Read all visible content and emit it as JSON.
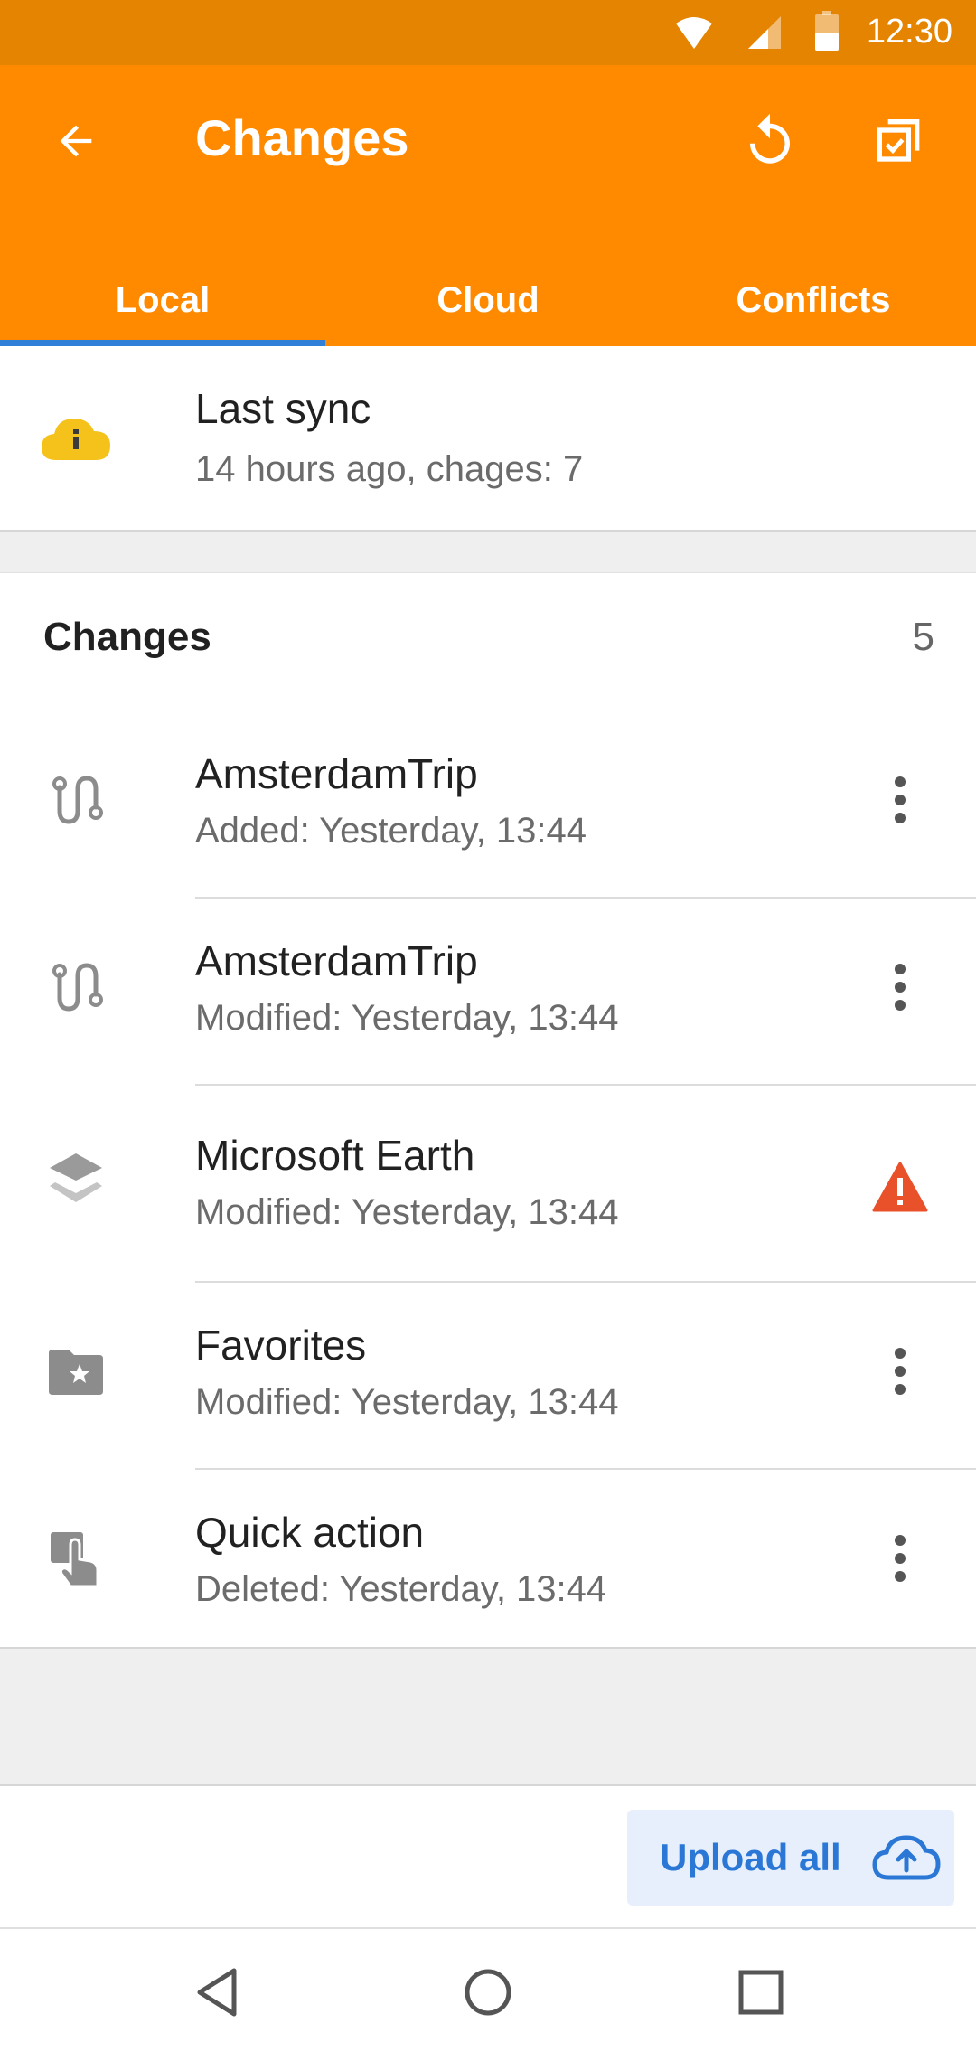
{
  "status_bar": {
    "time": "12:30"
  },
  "app_bar": {
    "title": "Changes",
    "tabs": [
      {
        "label": "Local",
        "selected": true
      },
      {
        "label": "Cloud",
        "selected": false
      },
      {
        "label": "Conflicts",
        "selected": false
      }
    ]
  },
  "sync": {
    "title": "Last sync",
    "subtitle": "14 hours ago, chages: 7"
  },
  "changes": {
    "header": "Changes",
    "count": "5",
    "items": [
      {
        "name": "AmsterdamTrip",
        "detail": "Added: Yesterday, 13:44",
        "icon": "route-icon",
        "action": "more-icon"
      },
      {
        "name": "AmsterdamTrip",
        "detail": "Modified: Yesterday, 13:44",
        "icon": "route-icon",
        "action": "more-icon"
      },
      {
        "name": "Microsoft Earth",
        "detail": "Modified: Yesterday, 13:44",
        "icon": "layers-icon",
        "action": "warning-icon"
      },
      {
        "name": "Favorites",
        "detail": "Modified: Yesterday, 13:44",
        "icon": "folder-star-icon",
        "action": "more-icon"
      },
      {
        "name": "Quick action",
        "detail": "Deleted: Yesterday, 13:44",
        "icon": "touch-icon",
        "action": "more-icon"
      }
    ]
  },
  "footer": {
    "upload_label": "Upload all"
  },
  "colors": {
    "app_bar": "#ff8a00",
    "status_bar": "#e58400",
    "accent_blue": "#2a77d6",
    "warning": "#e8512a",
    "sync_info": "#f5c21b"
  }
}
